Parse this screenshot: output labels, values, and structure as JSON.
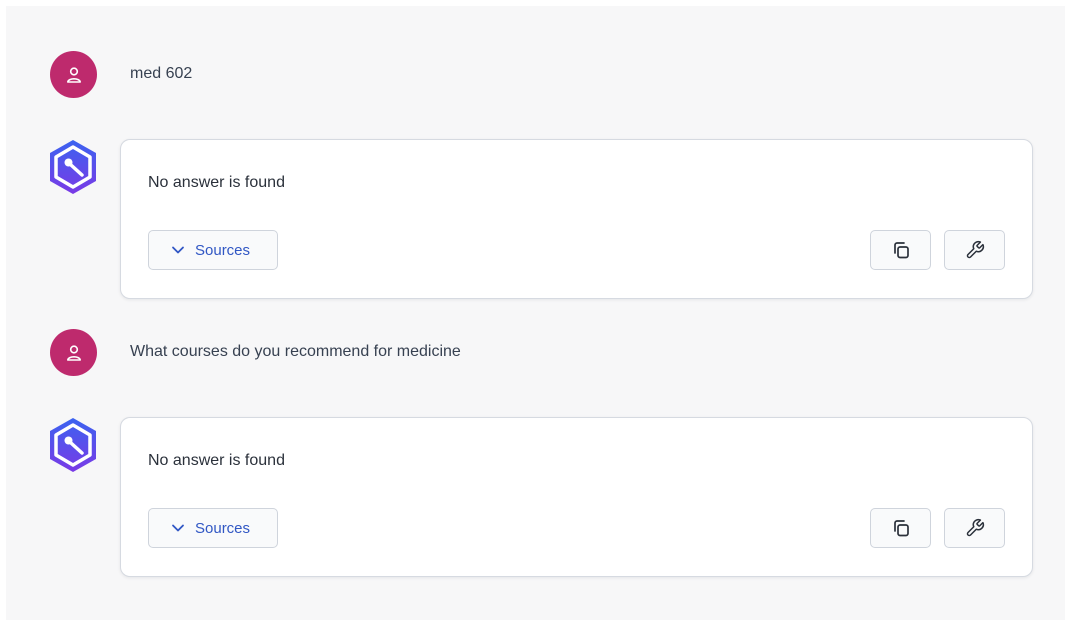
{
  "colors": {
    "panel_background": "#f7f7f8",
    "user_avatar": "#be2a6d",
    "bot_avatar_gradient": [
      "#3b63f0",
      "#7a3ae6"
    ],
    "sources_link": "#3157c4",
    "card_border": "#d6dae1"
  },
  "messages": [
    {
      "role": "user",
      "avatar_icon": "user-icon",
      "text": "med 602"
    },
    {
      "role": "assistant",
      "avatar_icon": "bot-logo-icon",
      "text": "No answer is found",
      "sources_label": "Sources",
      "sources_icon": "chevron-down-icon",
      "copy_icon": "copy-icon",
      "tool_icon": "wrench-icon"
    },
    {
      "role": "user",
      "avatar_icon": "user-icon",
      "text": "What courses do you recommend for medicine"
    },
    {
      "role": "assistant",
      "avatar_icon": "bot-logo-icon",
      "text": "No answer is found",
      "sources_label": "Sources",
      "sources_icon": "chevron-down-icon",
      "copy_icon": "copy-icon",
      "tool_icon": "wrench-icon"
    }
  ]
}
